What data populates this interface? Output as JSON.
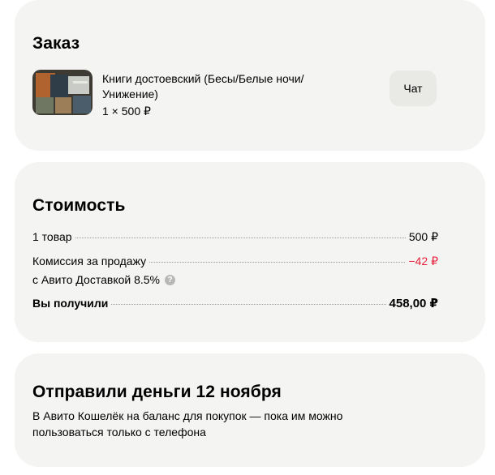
{
  "order": {
    "title": "Заказ",
    "item_title": "Книги достоевский (Бесы/Белые ночи/Унижение)",
    "item_qty": "1 × 500 ₽",
    "chat_button": "Чат"
  },
  "cost": {
    "title": "Стоимость",
    "rows": [
      {
        "label": "1 товар",
        "value": "500 ₽"
      },
      {
        "label": "Комиссия за продажу",
        "value": "−42 ₽"
      },
      {
        "label": "Вы получили",
        "value": "458,00 ₽"
      }
    ],
    "commission_sub": "с Авито Доставкой 8.5%",
    "help_icon": "?"
  },
  "sent": {
    "title": "Отправили деньги 12 ноября",
    "text": "В Авито Кошелёк на баланс для покупок — пока им можно пользоваться только с телефона"
  },
  "colors": {
    "card_bg": "#f4f4f2",
    "negative": "#e8203c"
  }
}
